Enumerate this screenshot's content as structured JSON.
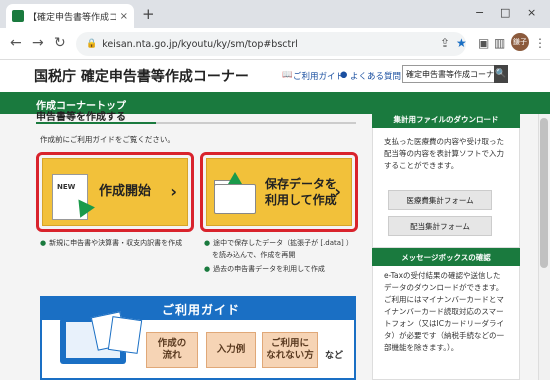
{
  "browser": {
    "tab_title": "【確定申告書等作成コーナー】-作成",
    "tab_close": "×",
    "new_tab": "+",
    "back": "←",
    "forward": "→",
    "reload": "↻",
    "url": "keisan.nta.go.jp/kyoutu/ky/sm/top#bsctrl",
    "profile_initials": "鎌子",
    "minimize": "−",
    "maximize": "□",
    "close": "×"
  },
  "header": {
    "title": "国税庁 確定申告書等作成コーナー",
    "guide_link": "ご利用ガイド",
    "faq_link": "よくある質問",
    "search_value": "確定申告書等作成コーナー",
    "search_button": "🔍"
  },
  "nav": {
    "label": "作成コーナートップ"
  },
  "main": {
    "section_title": "申告書等を作成する",
    "intro": "作成前にご利用ガイドをご覧ください。",
    "new_tag": "NEW",
    "start_button": "作成開始",
    "resume_button_line1": "保存データを",
    "resume_button_line2": "利用して作成",
    "chevron": "›",
    "start_note": "新規に申告書や決算書・収支内訳書を作成",
    "resume_note_1a": "途中で保存したデータ（拡張子が [.data] ）",
    "resume_note_1b": "を読み込んで、作成を再開",
    "resume_note_2": "過去の申告書データを利用して作成"
  },
  "guide": {
    "title": "ご利用ガイド",
    "btn_flow_1": "作成の",
    "btn_flow_2": "流れ",
    "btn_example": "入力例",
    "btn_unfamiliar_1": "ご利用に",
    "btn_unfamiliar_2": "なれない方",
    "more": "など"
  },
  "sidebar": {
    "download_title": "集計用ファイルのダウンロード",
    "download_text": [
      "支払った医療費の内容や受け取った",
      "配当等の内容を表計算ソフトで入力",
      "することができます。"
    ],
    "btn_medical": "医療費集計フォーム",
    "btn_dividend": "配当集計フォーム",
    "msgbox_title": "メッセージボックスの確認",
    "msgbox_text": [
      "e-Taxの受付結果の確認や送信した",
      "データのダウンロードができます。",
      "ご利用にはマイナンバーカードとマ",
      "イナンバーカード読取対応のスマー",
      "トフォン（又はICカードリーダライ",
      "タ）が必要です（納税手続などの一",
      "部機能を除きます。）。"
    ]
  }
}
